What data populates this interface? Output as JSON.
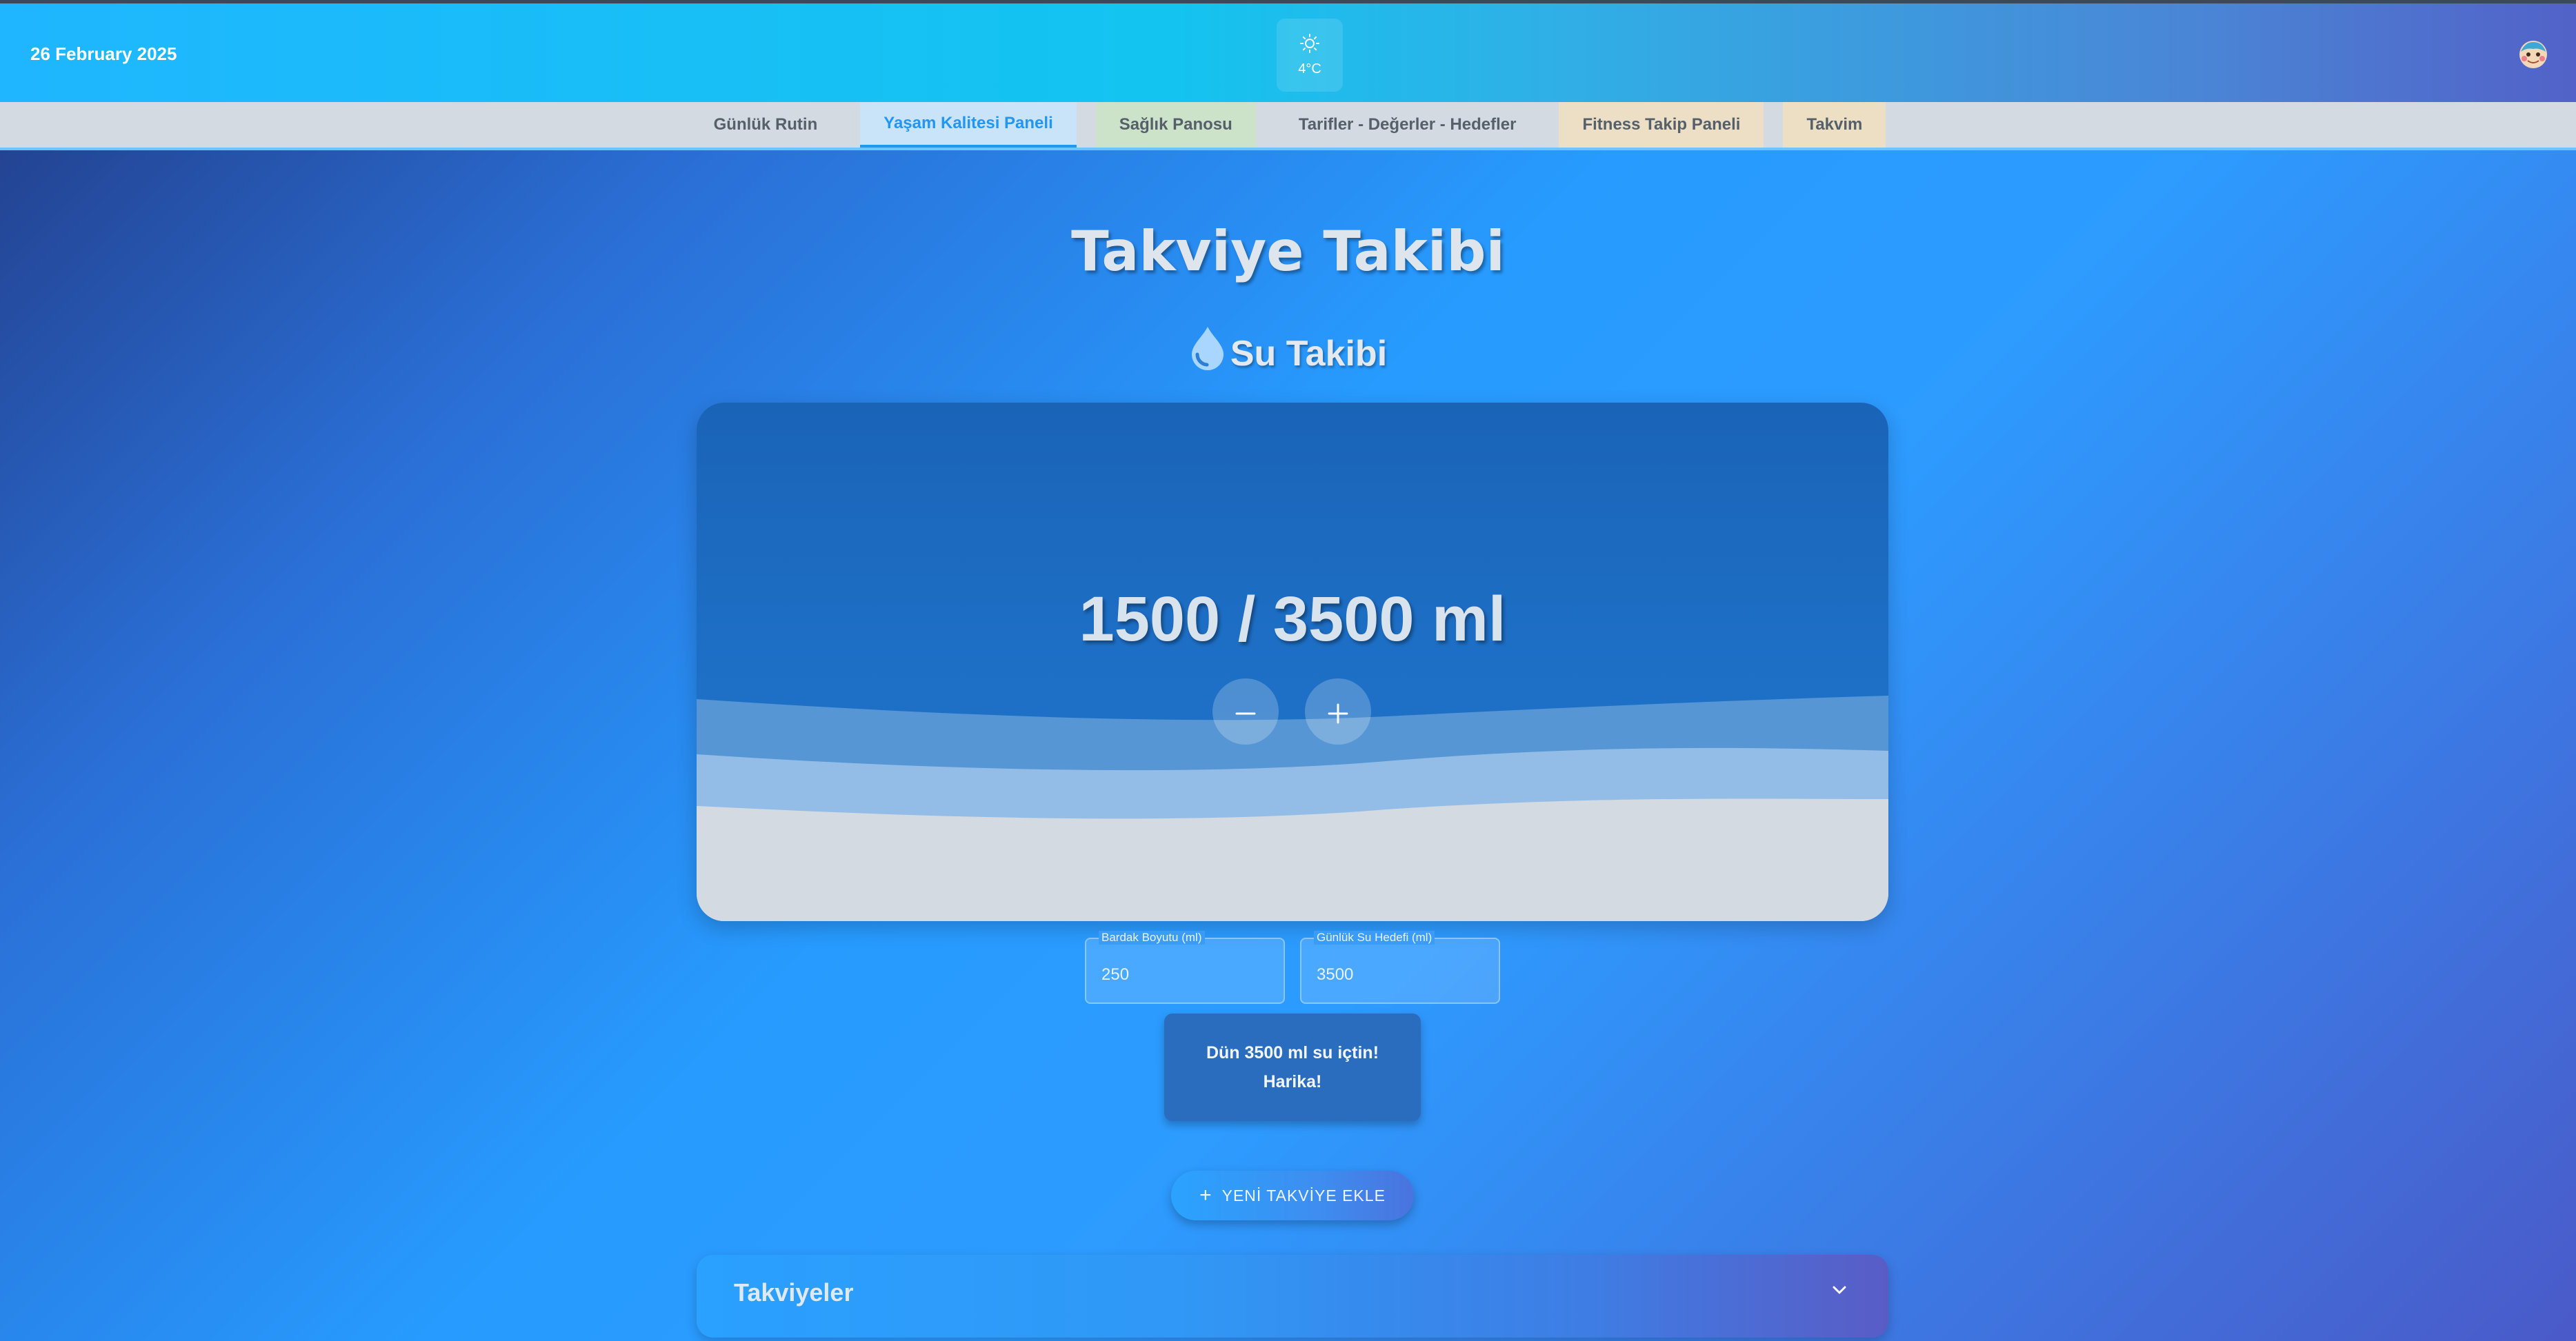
{
  "header": {
    "date": "26 February 2025",
    "weather": {
      "icon": "sun-icon",
      "temperature": "4°C"
    },
    "avatar_icon": "user-avatar-icon"
  },
  "nav": {
    "tabs": [
      {
        "label": "Günlük Rutin"
      },
      {
        "label": "Yaşam Kalitesi Paneli",
        "active": true
      },
      {
        "label": "Sağlık Panosu"
      },
      {
        "label": "Tarifler - Değerler - Hedefler"
      },
      {
        "label": "Fitness Takip Paneli"
      },
      {
        "label": "Takvim"
      }
    ]
  },
  "main": {
    "page_title": "Takviye Takibi",
    "water": {
      "section_title": "Su Takibi",
      "section_icon": "water-drop-icon",
      "amount_text": "1500 / 3500 ml",
      "consumed_ml": 1500,
      "goal_ml": 3500,
      "decrease_icon": "minus-icon",
      "increase_icon": "plus-icon",
      "cup_size": {
        "label": "Bardak Boyutu (ml)",
        "value": "250"
      },
      "daily_goal": {
        "label": "Günlük Su Hedefi (ml)",
        "value": "3500"
      },
      "message_line1": "Dün 3500 ml su içtin!",
      "message_line2": "Harika!"
    },
    "add_supplement_label": "YENİ TAKVİYE EKLE",
    "supplements": {
      "title": "Takviyeler",
      "toggle_icon": "chevron-down-icon"
    }
  },
  "colors": {
    "accent": "#2196f3",
    "card_water": "#1d6fc6",
    "wave_light": "#d3dae1"
  }
}
